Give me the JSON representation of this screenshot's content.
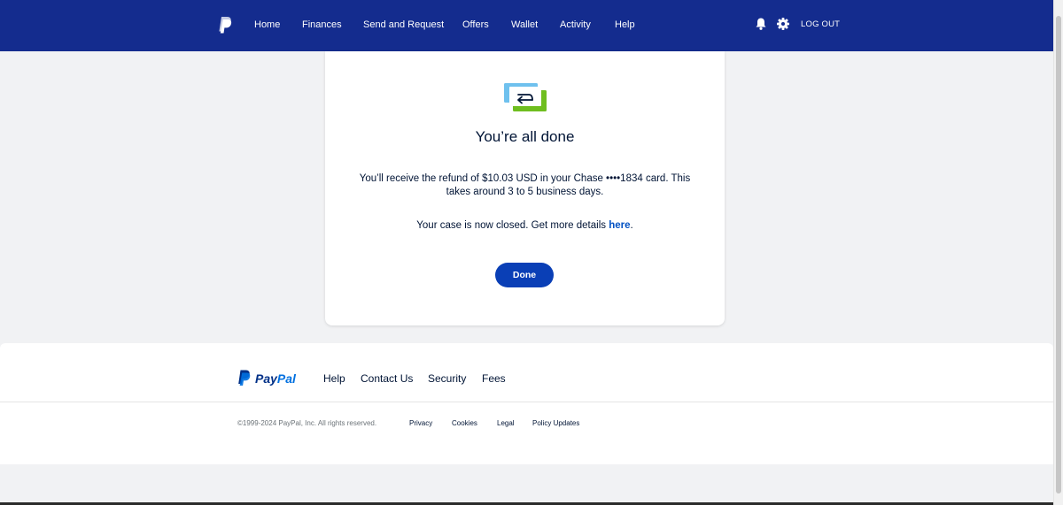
{
  "header": {
    "nav": [
      "Home",
      "Finances",
      "Send and Request",
      "Offers",
      "Wallet",
      "Activity",
      "Help"
    ],
    "icons": [
      "bell-icon",
      "gear-icon"
    ],
    "logout": "LOG OUT",
    "bg_color": "#142c8e"
  },
  "card": {
    "icon": "refund-return-icon",
    "title": "You’re all done",
    "message": "You’ll receive the refund of $10.03 USD in your Chase ••••1834 card. This takes around 3 to 5 business days.",
    "case_text": "Your case is now closed. Get more details ",
    "case_link": "here",
    "case_suffix": ".",
    "done_button": "Done",
    "button_color": "#0a3fb6"
  },
  "footer": {
    "logo_pay": "Pay",
    "logo_pal": "Pal",
    "links": [
      "Help",
      "Contact Us",
      "Security",
      "Fees"
    ],
    "copyright": "©1999-2024 PayPal, Inc. All rights reserved.",
    "legal_links": [
      "Privacy",
      "Cookies",
      "Legal",
      "Policy Updates"
    ]
  }
}
